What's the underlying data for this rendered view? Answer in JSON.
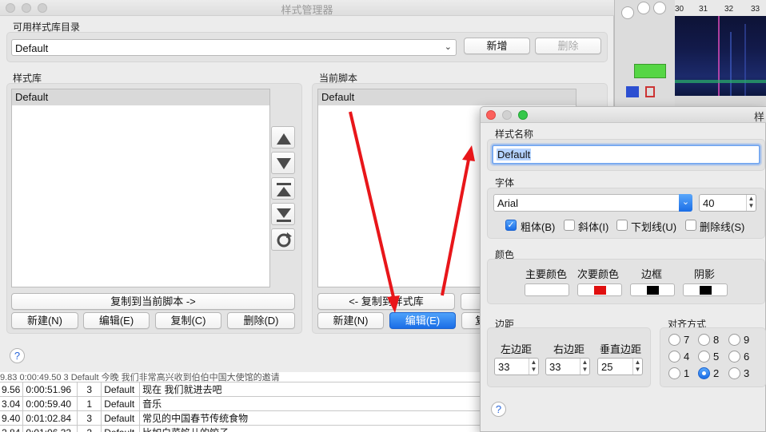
{
  "main_window": {
    "title": "样式管理器",
    "catalog_label": "可用样式库目录",
    "catalog_value": "Default",
    "new_label": "新增",
    "delete_label": "删除",
    "storage_label": "样式库",
    "storage_items": [
      "Default"
    ],
    "script_label": "当前脚本",
    "script_items": [
      "Default"
    ],
    "copy_to_script_label": "复制到当前脚本 ->",
    "copy_to_storage_label": "<- 复制到样式库",
    "left_buttons": [
      "新建(N)",
      "编辑(E)",
      "复制(C)",
      "删除(D)"
    ],
    "right_buttons": [
      "新建(N)",
      "编辑(E)",
      "复"
    ],
    "help": "?"
  },
  "subtitles": [
    {
      "start": "9.56",
      "end": "0:00:51.96",
      "layer": "3",
      "style": "Default",
      "text": "现在 我们就进去吧"
    },
    {
      "start": "3.04",
      "end": "0:00:59.40",
      "layer": "1",
      "style": "Default",
      "text": "音乐"
    },
    {
      "start": "9.40",
      "end": "0:01:02.84",
      "layer": "3",
      "style": "Default",
      "text": "常见的中国春节传统食物"
    },
    {
      "start": "2.84",
      "end": "0:01:06.32",
      "layer": "2",
      "style": "Default",
      "text": "比如白菜馅儿的饺子"
    }
  ],
  "partial_row": "9.83  0:00:49.50  3  Default  今晚 我们非常高兴收到伯伯中国大使馆的邀请",
  "timeline_numbers": [
    "30",
    "31",
    "32",
    "33"
  ],
  "editor": {
    "title": "样",
    "style_name_label": "样式名称",
    "style_name_value": "Default",
    "font_label": "字体",
    "font_value": "Arial",
    "font_size": "40",
    "bold_label": "粗体(B)",
    "italic_label": "斜体(I)",
    "underline_label": "下划线(U)",
    "strike_label": "删除线(S)",
    "colors_label": "颜色",
    "primary_label": "主要颜色",
    "secondary_label": "次要颜色",
    "outline_label": "边框",
    "shadow_label": "阴影",
    "margins_label": "边距",
    "left_margin_label": "左边距",
    "right_margin_label": "右边距",
    "vertical_margin_label": "垂直边距",
    "left_margin": "33",
    "right_margin": "33",
    "vertical_margin": "25",
    "alignment_label": "对齐方式",
    "alignment_options": [
      "7",
      "8",
      "9",
      "4",
      "5",
      "6",
      "1",
      "2",
      "3"
    ],
    "help": "?"
  },
  "colors": {
    "primary": "#ffffff",
    "secondary": "#e01010",
    "outline": "#000000",
    "shadow": "#000000",
    "accent": "#1a6de6",
    "arrow": "#e8161a"
  }
}
